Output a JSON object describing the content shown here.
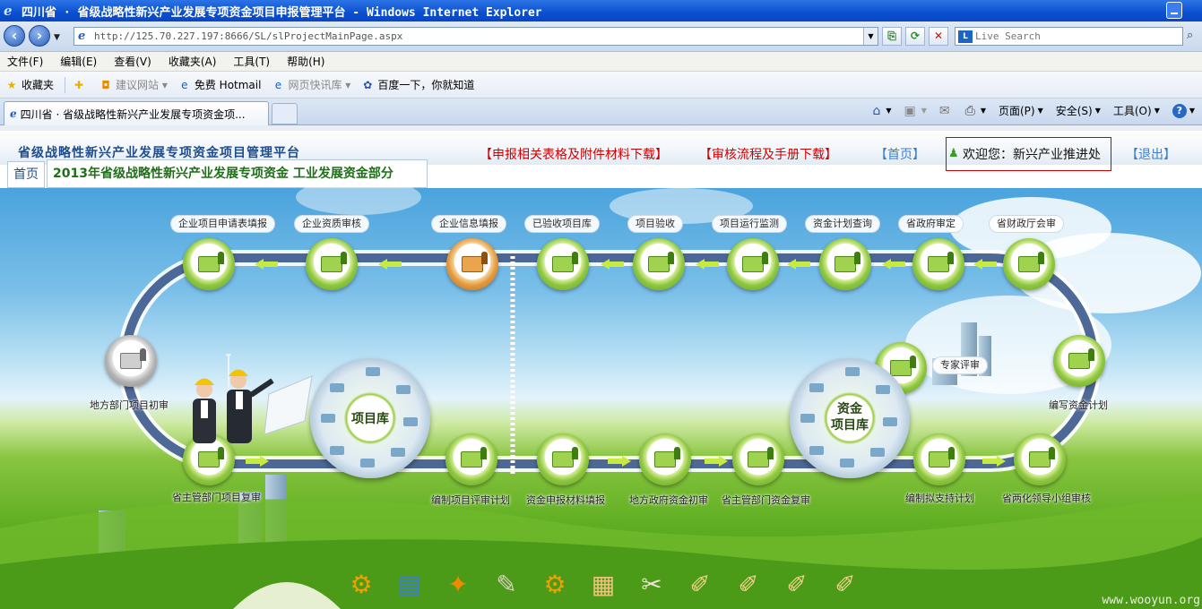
{
  "window": {
    "title": "四川省 · 省级战略性新兴产业发展专项资金项目申报管理平台 - Windows Internet Explorer",
    "tab_title": "四川省 · 省级战略性新兴产业发展专项资金项..."
  },
  "address_bar": {
    "url": "http://125.70.227.197:8666/SL/slProjectMainPage.aspx",
    "search_placeholder": "Live Search"
  },
  "menu": [
    "文件(F)",
    "编辑(E)",
    "查看(V)",
    "收藏夹(A)",
    "工具(T)",
    "帮助(H)"
  ],
  "favorites_bar": {
    "favorites": "收藏夹",
    "items": [
      "建议网站 ▾",
      "免费 Hotmail",
      "网页快讯库 ▾",
      "百度一下，你就知道"
    ]
  },
  "command_bar": {
    "page": "页面(P)",
    "safety": "安全(S)",
    "tools": "工具(O)",
    "help": "?"
  },
  "header": {
    "platform_name": "省级战略性新兴产业发展专项资金项目管理平台",
    "link_forms": "【申报相关表格及附件材料下载】",
    "link_manual": "【审核流程及手册下载】",
    "link_home": "【首页】",
    "welcome": "欢迎您：新兴产业推进处",
    "link_logout": "【退出】"
  },
  "tabs": {
    "home": "首页",
    "title": "2013年省级战略性新兴产业发展专项资金 工业发展资金部分"
  },
  "flow": {
    "top_labels": [
      "企业项目申请表填报",
      "企业资质审核",
      "企业信息填报",
      "已验收项目库",
      "项目验收",
      "项目运行监测",
      "资金计划查询",
      "省政府审定",
      "省财政厅会审"
    ],
    "bottom_labels": [
      "省主管部门项目复审",
      "编制项目评审计划",
      "资金申报材料填报",
      "地方政府资金初审",
      "省主管部门资金复审",
      "编制拟支持计划",
      "省两化领导小组审核"
    ],
    "side_labels": {
      "local_initial": "地方部门项目初审",
      "expert_review": "专家评审",
      "fund_plan": "编写资金计划"
    },
    "hub_project": "项目库",
    "hub_fund_line1": "资金",
    "hub_fund_line2": "项目库"
  },
  "watermark": "www.wooyun.org",
  "icons": [
    "ie-logo-icon",
    "back-icon",
    "forward-icon",
    "refresh-icon",
    "stop-icon",
    "home-icon",
    "rss-icon",
    "mail-icon",
    "print-icon",
    "help-icon",
    "user-icon",
    "star-icon"
  ]
}
